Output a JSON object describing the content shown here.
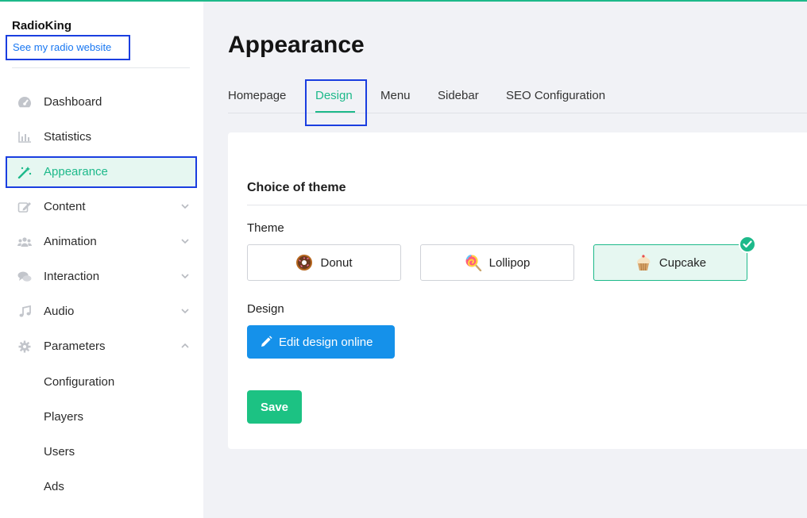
{
  "sidebar": {
    "brand": "RadioKing",
    "site_link": "See my radio website",
    "items": [
      {
        "label": "Dashboard",
        "icon": "gauge-icon"
      },
      {
        "label": "Statistics",
        "icon": "bar-chart-icon"
      },
      {
        "label": "Appearance",
        "icon": "magic-wand-icon",
        "active": true
      },
      {
        "label": "Content",
        "icon": "edit-icon",
        "expandable": true
      },
      {
        "label": "Animation",
        "icon": "users-icon",
        "expandable": true
      },
      {
        "label": "Interaction",
        "icon": "chat-icon",
        "expandable": true
      },
      {
        "label": "Audio",
        "icon": "music-note-icon",
        "expandable": true
      },
      {
        "label": "Parameters",
        "icon": "gear-icon",
        "expanded": true
      }
    ],
    "sub_items": [
      "Configuration",
      "Players",
      "Users",
      "Ads"
    ]
  },
  "main": {
    "title": "Appearance",
    "tabs": [
      "Homepage",
      "Design",
      "Menu",
      "Sidebar",
      "SEO Configuration"
    ],
    "active_tab": "Design",
    "section_title": "Choice of theme",
    "theme_label": "Theme",
    "themes": [
      {
        "label": "Donut",
        "icon": "donut-icon"
      },
      {
        "label": "Lollipop",
        "icon": "lollipop-icon"
      },
      {
        "label": "Cupcake",
        "icon": "cupcake-icon",
        "selected": true
      }
    ],
    "design_label": "Design",
    "edit_button": "Edit design online",
    "save_button": "Save"
  },
  "colors": {
    "accent": "#1db98a",
    "primary_button": "#1591ea",
    "save_button": "#1cc283",
    "highlight_outline": "#1a3ee0"
  }
}
